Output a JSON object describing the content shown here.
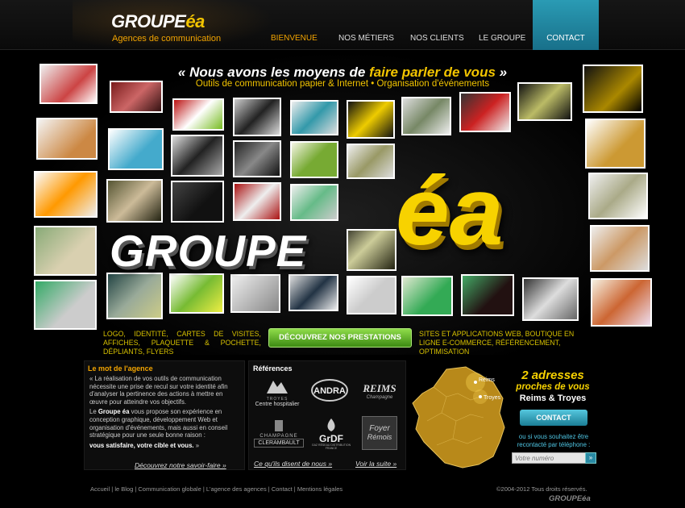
{
  "header": {
    "logo_main": "GROUPE",
    "logo_ea": "éa",
    "logo_tagline": "Agences de communication",
    "nav": [
      "BIENVENUE",
      "NOS MÉTIERS",
      "NOS CLIENTS",
      "LE GROUPE"
    ],
    "nav_contact": "CONTACT",
    "accent": "#f2a400",
    "contact_color": "#2a9bb4"
  },
  "hero": {
    "slogan_pre": "« Nous avons les moyens de ",
    "slogan_hl": "faire parler de vous",
    "slogan_post": " »",
    "subslogan": "Outils de communication papier & Internet  •  Organisation d'événements",
    "big_groupe": "GROUPE",
    "big_ea": "éa"
  },
  "services": {
    "left": "Logo, identité, cartes de visites, affiches, plaquette & pochette, dépliants, flyers",
    "right": "Sites et applications web, boutique en ligne e-commerce, référencement, optimisation",
    "button": "DÉCOUVREZ NOS PRESTATIONS",
    "button_color": "#5fb52a"
  },
  "mot": {
    "title": "Le mot de l'agence",
    "p1": "« La réalisation de vos outils de communication nécessite une prise de recul sur votre identité afin d'analyser la pertinence des actions à mettre en œuvre pour atteindre vos objectifs.",
    "p2_pre": "Le ",
    "p2_bold": "Groupe éa",
    "p2_post": " vous propose son expérience en conception graphique, développement Web et organisation d'événements, mais aussi en conseil stratégique pour une seule bonne raison :",
    "p3": "vous satisfaire, votre cible et vous.",
    "p3_post": " »",
    "link": "Découvrez notre savoir-faire »"
  },
  "references": {
    "title": "Références",
    "logos": [
      {
        "line1": "TROYES",
        "line2": "Centre hospitalier"
      },
      {
        "line1": "ANDRA",
        "line2": ""
      },
      {
        "line1": "REIMS",
        "line2": "Champagne"
      },
      {
        "line1": "CHAMPAGNE",
        "line2": "CLERAMBAULT"
      },
      {
        "line1": "GrDF",
        "line2": "GAZ RÉSEAU DISTRIBUTION FRANCE"
      },
      {
        "line1": "Foyer",
        "line2": "Rémois"
      }
    ],
    "link_left": "Ce qu'ils disent de nous »",
    "link_right": "Voir la suite »"
  },
  "contact_block": {
    "map_label_1": "Reims",
    "map_label_2": "Troyes",
    "title": "2 adresses",
    "subtitle": "proches de vous",
    "cities": "Reims & Troyes",
    "button": "CONTACT",
    "recall": "ou si vous souhaitez être recontacté par téléphone :",
    "phone_placeholder": "Votre numéro",
    "phone_btn": "»"
  },
  "footer": {
    "links": [
      "Accueil",
      "le Blog",
      "Communication globale",
      "L'agence des agences",
      "Contact",
      "Mentions légales"
    ],
    "copyright": "©2004-2012 Tous droits réservés.",
    "logo": "GROUPEéa"
  }
}
